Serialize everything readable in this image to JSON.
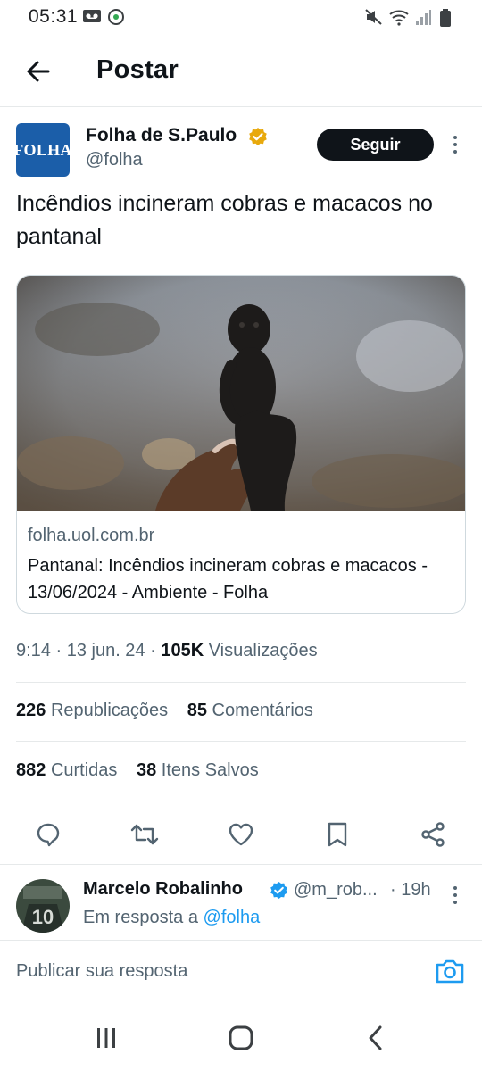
{
  "status_bar": {
    "time": "05:31",
    "icons": [
      "voicemail-icon",
      "assistant-icon",
      "mute-icon",
      "wifi-icon",
      "signal-icon",
      "battery-icon"
    ]
  },
  "header": {
    "title": "Postar",
    "back_icon": "arrow-left-icon"
  },
  "post": {
    "author": {
      "name": "Folha de S.Paulo",
      "handle": "@folha",
      "avatar_text": "FOLHA",
      "verified_color": "#e8a90c"
    },
    "follow_label": "Seguir",
    "text": "Incêndios incineram cobras e macacos no pantanal",
    "card": {
      "domain": "folha.uol.com.br",
      "title": "Pantanal: Incêndios incineram cobras e macacos - 13/06/2024 - Ambiente - Folha"
    },
    "meta": {
      "time_date": "9:14 · 13 jun. 24 · ",
      "views_count": "105K",
      "views_label": "Visualizações"
    },
    "stats": {
      "reposts_count": "226",
      "reposts_label": "Republicações",
      "comments_count": "85",
      "comments_label": "Comentários",
      "likes_count": "882",
      "likes_label": "Curtidas",
      "saves_count": "38",
      "saves_label": "Itens Salvos"
    },
    "actions": [
      "reply-icon",
      "repost-icon",
      "like-icon",
      "bookmark-icon",
      "share-icon"
    ]
  },
  "reply": {
    "name": "Marcelo Robalinho",
    "handle": "@m_rob...",
    "time": "· 19h",
    "reply_to_prefix": "Em resposta a ",
    "reply_to_mention": "@folha",
    "avatar_text": "10"
  },
  "composer": {
    "placeholder": "Publicar sua resposta"
  },
  "nav": [
    "recents-icon",
    "home-icon",
    "back-icon"
  ],
  "colors": {
    "accent": "#1d9bf0",
    "text": "#0f1419",
    "muted": "#536471",
    "folha_blue": "#1b5ea9"
  }
}
